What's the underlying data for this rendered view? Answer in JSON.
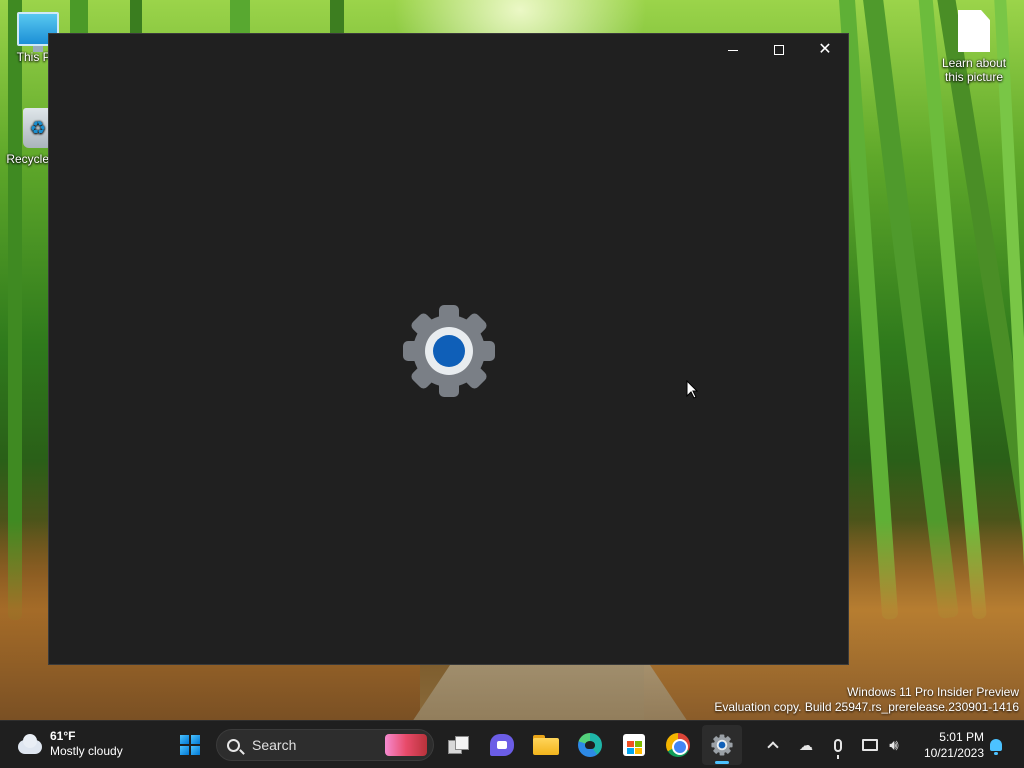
{
  "desktop": {
    "icons": [
      {
        "label": "This PC",
        "icon": "computer-icon"
      },
      {
        "label": "Recycle Bin",
        "icon": "recycle-bin-icon"
      },
      {
        "label": "Learn about this picture",
        "icon": "document-icon"
      }
    ],
    "watermark": {
      "line1": "Windows 11 Pro Insider Preview",
      "line2": "Evaluation copy. Build 25947.rs_prerelease.230901-1416"
    }
  },
  "window": {
    "app": "Settings",
    "state": "loading splash",
    "splash_icon": "gear-icon",
    "colors": {
      "background": "#202020",
      "gear": "#7a7f86",
      "gear_center": "#0f5fb8"
    },
    "caption_buttons": [
      "minimize",
      "maximize",
      "close"
    ]
  },
  "taskbar": {
    "weather": {
      "temperature": "61°F",
      "condition": "Mostly cloudy",
      "icon": "cloud-icon"
    },
    "search": {
      "placeholder": "Search"
    },
    "apps": [
      {
        "name": "Start",
        "icon": "windows-logo-icon"
      },
      {
        "name": "Task View",
        "icon": "task-view-icon"
      },
      {
        "name": "Chat",
        "icon": "chat-icon"
      },
      {
        "name": "File Explorer",
        "icon": "folder-icon"
      },
      {
        "name": "Microsoft Edge",
        "icon": "edge-icon"
      },
      {
        "name": "Microsoft Store",
        "icon": "store-icon"
      },
      {
        "name": "Google Chrome",
        "icon": "chrome-icon"
      },
      {
        "name": "Settings",
        "icon": "gear-icon",
        "active": true
      }
    ],
    "tray": {
      "icons": [
        "chevron-up-icon",
        "onedrive-icon",
        "microphone-icon",
        "network-icon",
        "volume-icon"
      ],
      "time": "5:01 PM",
      "date": "10/21/2023",
      "notification_icon": "bell-icon"
    },
    "colors": {
      "background": "#1f1f1f",
      "accent": "#4cc2ff"
    }
  }
}
